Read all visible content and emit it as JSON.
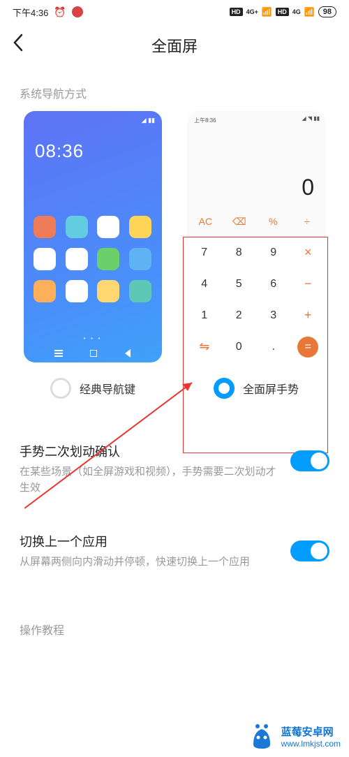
{
  "status_bar": {
    "time": "下午4:36",
    "battery": "98"
  },
  "header": {
    "title": "全面屏"
  },
  "section_label": "系统导航方式",
  "preview_home": {
    "time": "08:36",
    "icon_colors": [
      "#ee7c59",
      "#62cde0",
      "#ffffff",
      "#ffd457",
      "#ffffff",
      "#ffffff",
      "#6bd069",
      "#5eb3f5",
      "#ffae5a",
      "#ffffff",
      "#ffd772",
      "#5cc8b5"
    ]
  },
  "preview_calc": {
    "status_time": "上午8:36",
    "display": "0",
    "ops": [
      "AC",
      "⌫",
      "%",
      "÷"
    ],
    "keys": [
      "7",
      "8",
      "9",
      "×",
      "4",
      "5",
      "6",
      "−",
      "1",
      "2",
      "3",
      "+",
      "⇋",
      "0",
      ".",
      "="
    ]
  },
  "choices": {
    "classic": "经典导航键",
    "gesture": "全面屏手势"
  },
  "settings": {
    "confirm": {
      "title": "手势二次划动确认",
      "desc": "在某些场景（如全屏游戏和视频），手势需要二次划动才生效"
    },
    "switch_app": {
      "title": "切换上一个应用",
      "desc": "从屏幕两侧向内滑动并停顿，快速切换上一个应用"
    }
  },
  "tutorial_label": "操作教程",
  "watermark": {
    "title": "蓝莓安卓网",
    "url": "www.lmkjst.com"
  }
}
